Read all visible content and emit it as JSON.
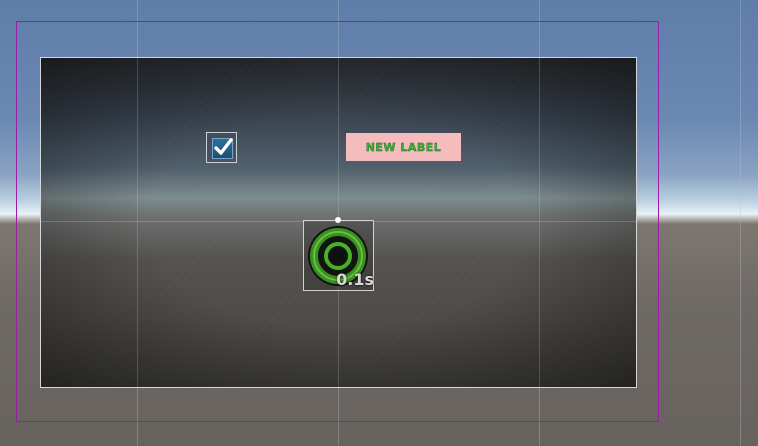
{
  "scene": {
    "label_text": "NEW LABEL",
    "cooldown_text": "0.1s",
    "toggle_checked": true
  },
  "icons": {
    "toggle_check": "checkmark-icon",
    "cooldown": "ring-cooldown-icon",
    "pivot": "pivot-handle-icon"
  },
  "colors": {
    "canvas_frame": "#9b1fa6",
    "label_background": "#f4bcbc",
    "label_text": "#3fae3a",
    "ring": "#4caf2a",
    "toggle_box": "#2f6f9b"
  }
}
